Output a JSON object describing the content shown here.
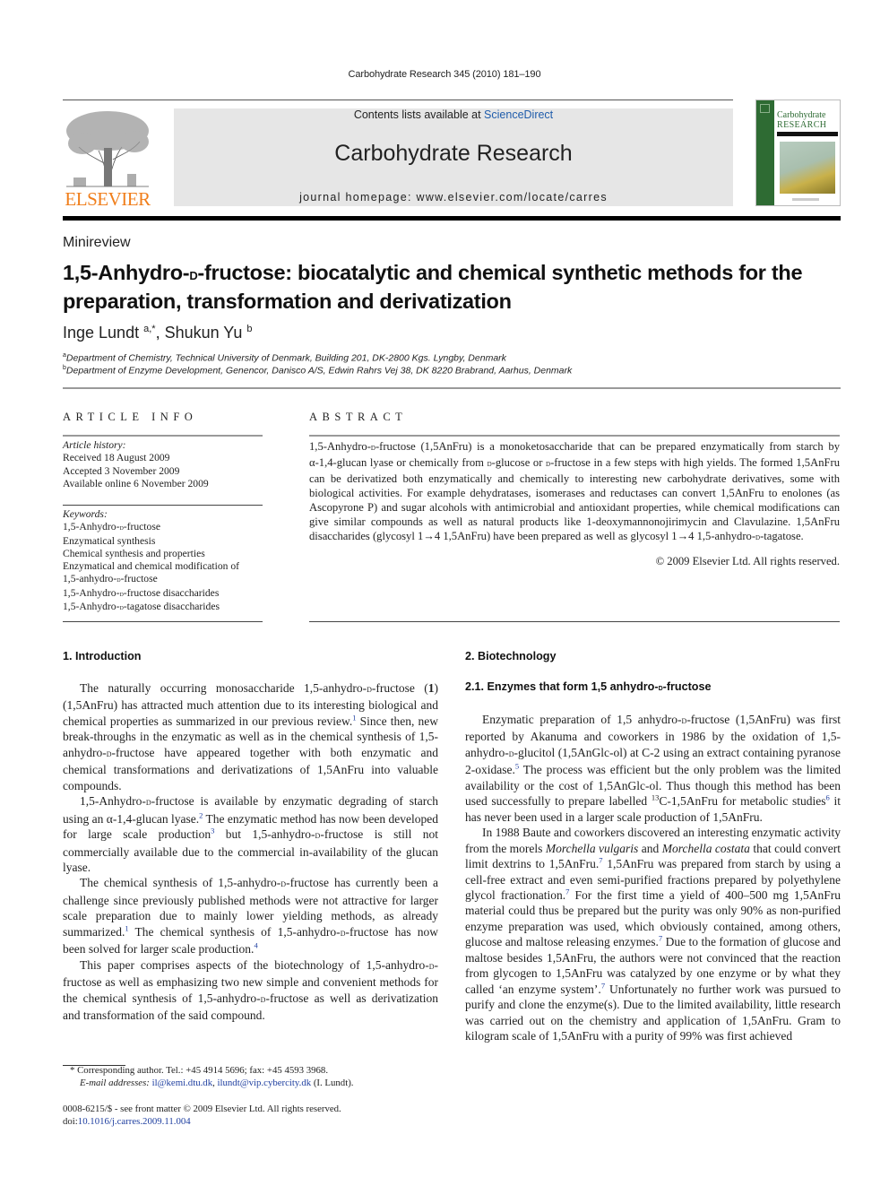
{
  "header": {
    "journal_ref": "Carbohydrate Research 345 (2010) 181–190",
    "contents_prefix": "Contents lists available at ",
    "contents_link": "ScienceDirect",
    "journal_title": "Carbohydrate Research",
    "homepage": "journal homepage: www.elsevier.com/locate/carres",
    "publisher_logo_text": "ELSEVIER",
    "cover_title_line1": "Carbohydrate",
    "cover_title_line2": "RESEARCH",
    "colors": {
      "elsevier_orange": "#f07e1b",
      "link_blue": "#1f5cab",
      "cover_green": "#2e6b33",
      "banner_gray": "#e6e6e6"
    }
  },
  "article": {
    "type": "Minireview",
    "title_part1": "1,5-Anhydro-",
    "title_sc": "d",
    "title_part2": "-fructose: biocatalytic and chemical synthetic methods for the preparation, transformation and derivatization",
    "authors": [
      {
        "name": "Inge Lundt",
        "marks": "a,*"
      },
      {
        "name": "Shukun Yu",
        "marks": "b"
      }
    ],
    "affiliations": [
      {
        "mark": "a",
        "text": "Department of Chemistry, Technical University of Denmark, Building 201, DK-2800 Kgs. Lyngby, Denmark"
      },
      {
        "mark": "b",
        "text": "Department of Enzyme Development, Genencor, Danisco A/S, Edwin Rahrs Vej 38, DK 8220 Brabrand, Aarhus, Denmark"
      }
    ]
  },
  "article_info": {
    "heading": "ARTICLE INFO",
    "history_label": "Article history:",
    "history": [
      "Received 18 August 2009",
      "Accepted 3 November 2009",
      "Available online 6 November 2009"
    ],
    "keywords_label": "Keywords:",
    "keywords": [
      "1,5-Anhydro-D-fructose",
      "Enzymatical synthesis",
      "Chemical synthesis and properties",
      "Enzymatical and chemical modification of",
      "1,5-anhydro-D-fructose",
      "1,5-Anhydro-D-fructose disaccharides",
      "1,5-Anhydro-D-tagatose disaccharides"
    ]
  },
  "abstract": {
    "heading": "ABSTRACT",
    "text": "1,5-Anhydro-D-fructose (1,5AnFru) is a monoketosaccharide that can be prepared enzymatically from starch by α-1,4-glucan lyase or chemically from D-glucose or D-fructose in a few steps with high yields. The formed 1,5AnFru can be derivatized both enzymatically and chemically to interesting new carbohydrate derivatives, some with biological activities. For example dehydratases, isomerases and reductases can convert 1,5AnFru to enolones (as Ascopyrone P) and sugar alcohols with antimicrobial and antioxidant properties, while chemical modifications can give similar compounds as well as natural products like 1-deoxymannonojirimycin and Clavulazine. 1,5AnFru disaccharides (glycosyl 1→4 1,5AnFru) have been prepared as well as glycosyl 1→4 1,5-anhydro-D-tagatose.",
    "copyright": "© 2009 Elsevier Ltd. All rights reserved."
  },
  "body": {
    "sec1_heading": "1.  Introduction",
    "sec1_paragraphs": [
      "The naturally occurring monosaccharide 1,5-anhydro-D-fructose (1) (1,5AnFru) has attracted much attention due to its interesting biological and chemical properties as summarized in our previous review.[1] Since then, new break-throughs in the enzymatic as well as in the chemical synthesis of 1,5-anhydro-D-fructose have appeared together with both enzymatic and chemical transformations and derivatizations of 1,5AnFru into valuable compounds.",
      "1,5-Anhydro-D-fructose is available by enzymatic degrading of starch using an α-1,4-glucan lyase.[2] The enzymatic method has now been developed for large scale production[3] but 1,5-anhydro-D-fructose is still not commercially available due to the commercial in-availability of the glucan lyase.",
      "The chemical synthesis of 1,5-anhydro-D-fructose has currently been a challenge since previously published methods were not attractive for larger scale preparation due to mainly lower yielding methods, as already summarized.[1] The chemical synthesis of 1,5-anhydro-D-fructose has now been solved for larger scale production.[4]",
      "This paper comprises aspects of the biotechnology of 1,5-anhydro-D-fructose as well as emphasizing two new simple and convenient methods for the chemical synthesis of 1,5-anhydro-D-fructose as well as derivatization and transformation of the said compound."
    ],
    "sec2_heading": "2.  Biotechnology",
    "sec21_heading": "2.1.  Enzymes that form 1,5 anhydro-D-fructose",
    "sec21_paragraphs": [
      "Enzymatic preparation of 1,5 anhydro-D-fructose (1,5AnFru) was first reported by Akanuma and coworkers in 1986 by the oxidation of 1,5-anhydro-D-glucitol (1,5AnGlc-ol) at C-2 using an extract containing pyranose 2-oxidase.[5] The process was efficient but the only problem was the limited availability or the cost of 1,5AnGlc-ol. Thus though this method has been used successfully to prepare labelled ^13C-1,5AnFru for metabolic studies[6] it has never been used in a larger scale production of 1,5AnFru.",
      "In 1988 Baute and coworkers discovered an interesting enzymatic activity from the morels _Morchella vulgaris_ and _Morchella costata_ that could convert limit dextrins to 1,5AnFru.[7] 1,5AnFru was prepared from starch by using a cell-free extract and even semi-purified fractions prepared by polyethylene glycol fractionation.[7] For the first time a yield of 400–500 mg 1,5AnFru material could thus be prepared but the purity was only 90% as non-purified enzyme preparation was used, which obviously contained, among others, glucose and maltose releasing enzymes.[7] Due to the formation of glucose and maltose besides 1,5AnFru, the authors were not convinced that the reaction from glycogen to 1,5AnFru was catalyzed by one enzyme or by what they called ‘an enzyme system’.[7] Unfortunately no further work was pursued to purify and clone the enzyme(s). Due to the limited availability, little research was carried out on the chemistry and application of 1,5AnFru. Gram to kilogram scale of 1,5AnFru with a purity of 99% was first achieved"
    ]
  },
  "footnotes": {
    "corresponding": "Corresponding author. Tel.: +45 4914 5696; fax: +45 4593 3968.",
    "email_label": "E-mail addresses: ",
    "emails": [
      "il@kemi.dtu.dk",
      "ilundt@vip.cybercity.dk"
    ],
    "email_suffix": " (I. Lundt).",
    "issn_line": "0008-6215/$ - see front matter © 2009 Elsevier Ltd. All rights reserved.",
    "doi_label": "doi:",
    "doi": "10.1016/j.carres.2009.11.004"
  }
}
